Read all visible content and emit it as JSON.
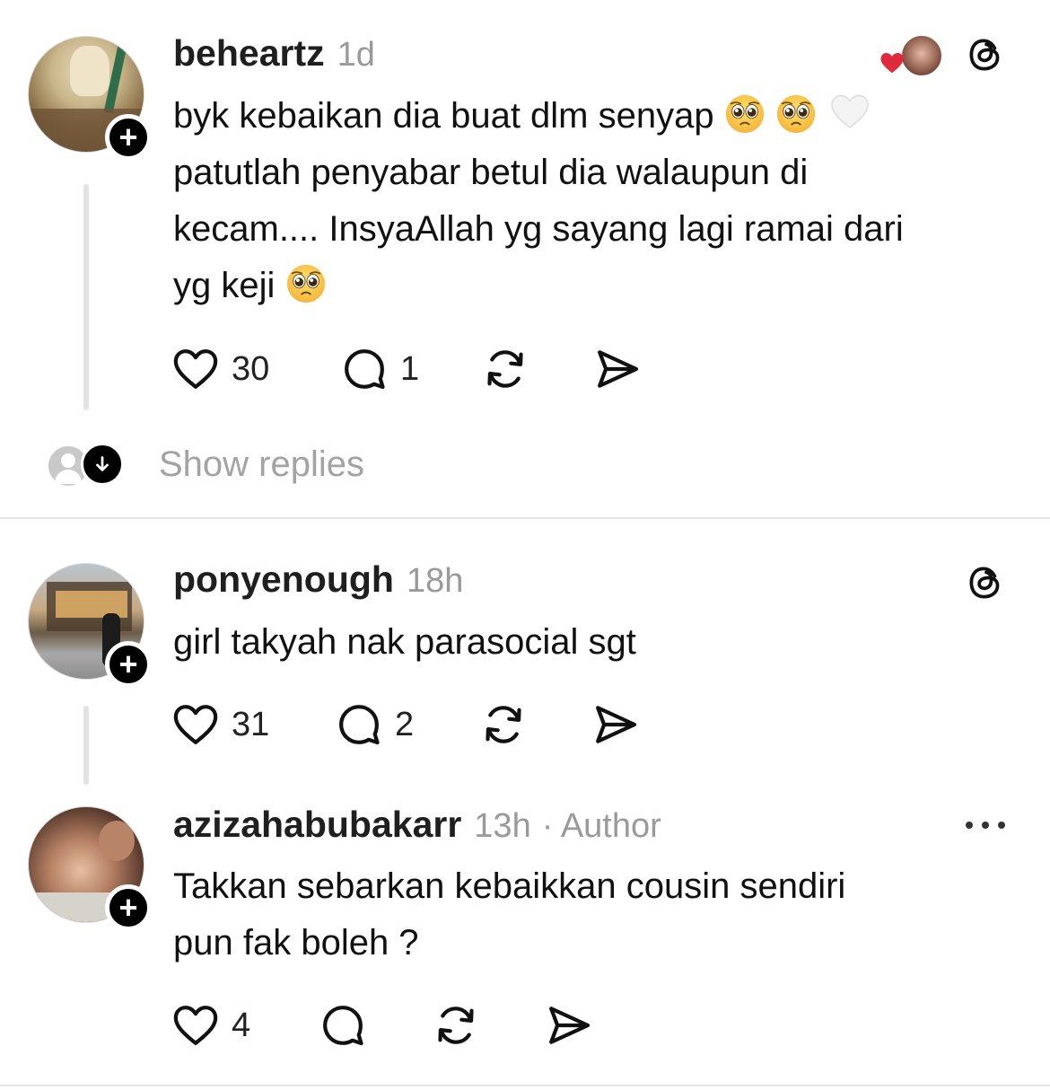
{
  "posts": [
    {
      "username": "beheartz",
      "time": "1d",
      "text_line1": "byk kebaikan dia buat dlm senyap",
      "text_line2": "patutlah penyabar betul dia walaupun di",
      "text_line3": "kecam.... InsyaAllah  yg sayang lagi ramai dari",
      "text_line4": "yg keji",
      "likes": "30",
      "replies": "1"
    },
    {
      "username": "ponyenough",
      "time": "18h",
      "text_line1": "girl takyah nak parasocial sgt",
      "likes": "31",
      "replies": "2"
    },
    {
      "username": "azizahabubakarr",
      "time": "13h",
      "author_tag": "· Author",
      "text_line1": "Takkan sebarkan kebaikkan cousin sendiri",
      "text_line2": "pun fak boleh ?",
      "likes": "4"
    }
  ],
  "show_replies_label": "Show replies",
  "icons": {
    "like": "heart-outline-icon",
    "reply": "speech-bubble-icon",
    "repost": "repost-icon",
    "share": "send-icon",
    "threads": "threads-logo-icon",
    "more": "more-dots-icon",
    "emoji": "pleading-face-emoji",
    "white_heart": "white-heart-emoji"
  },
  "colors": {
    "text": "#111111",
    "muted": "#9a9a9a",
    "like_red": "#e0293b"
  }
}
